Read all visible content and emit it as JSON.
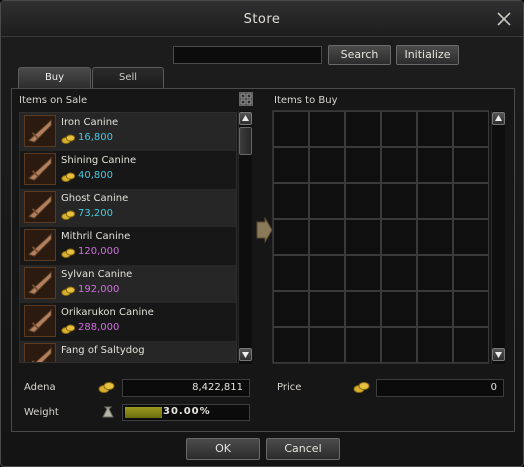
{
  "window": {
    "title": "Store"
  },
  "search": {
    "value": "",
    "button": "Search",
    "initialize": "Initialize"
  },
  "tabs": [
    {
      "label": "Buy",
      "active": true
    },
    {
      "label": "Sell",
      "active": false
    }
  ],
  "left_panel": {
    "label": "Items on Sale"
  },
  "right_panel": {
    "label": "Items to Buy"
  },
  "items": [
    {
      "name": "Iron Canine",
      "price": "16,800",
      "price_color": "#48c8e0",
      "icon": "sword-icon"
    },
    {
      "name": "Shining Canine",
      "price": "40,800",
      "price_color": "#48c8e0",
      "icon": "sword-icon"
    },
    {
      "name": "Ghost Canine",
      "price": "73,200",
      "price_color": "#48c8e0",
      "icon": "sword-icon"
    },
    {
      "name": "Mithril Canine",
      "price": "120,000",
      "price_color": "#d070e0",
      "icon": "sword-icon"
    },
    {
      "name": "Sylvan Canine",
      "price": "192,000",
      "price_color": "#d070e0",
      "icon": "sword-icon"
    },
    {
      "name": "Orikarukon Canine",
      "price": "288,000",
      "price_color": "#d070e0",
      "icon": "sword-icon"
    },
    {
      "name": "Fang of Saltydog",
      "price": "",
      "price_color": "#d070e0",
      "icon": "sword-icon"
    }
  ],
  "footer": {
    "adena_label": "Adena",
    "adena_value": "8,422,811",
    "weight_label": "Weight",
    "weight_text": "30.00%",
    "weight_fraction": 0.3,
    "price_label": "Price",
    "price_value": "0"
  },
  "buttons": {
    "ok": "OK",
    "cancel": "Cancel"
  },
  "colors": {
    "accent": "#9a9a1e",
    "cyan_price": "#48c8e0",
    "purple_price": "#d070e0"
  }
}
